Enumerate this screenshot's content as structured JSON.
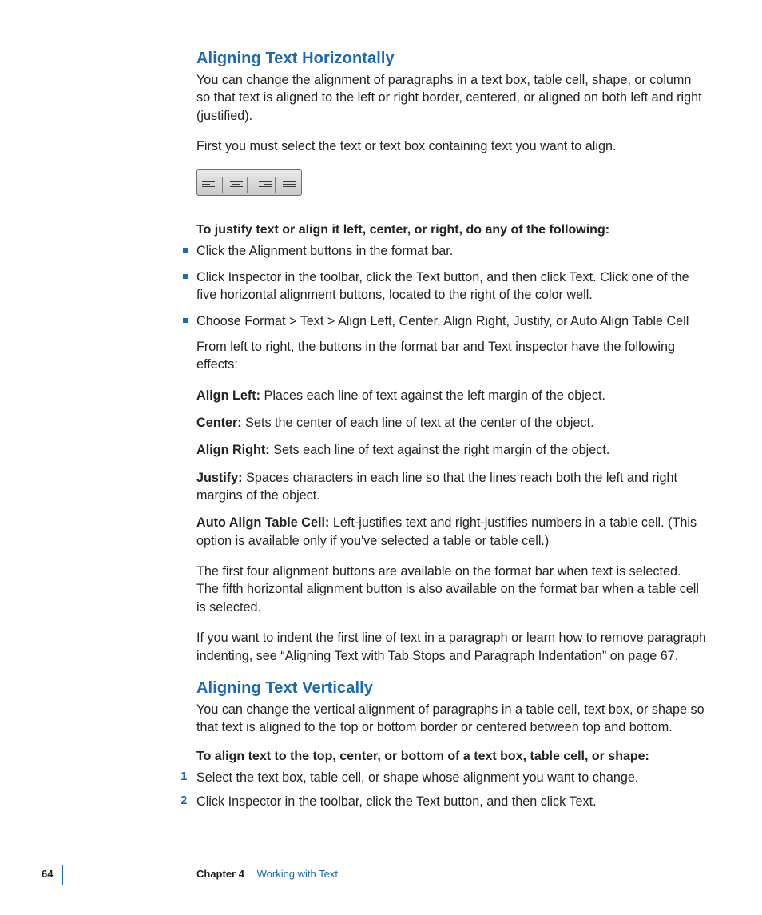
{
  "section1": {
    "heading": "Aligning Text Horizontally",
    "intro": "You can change the alignment of paragraphs in a text box, table cell, shape, or column so that text is aligned to the left or right border, centered, or aligned on both left and right (justified).",
    "selectNote": "First you must select the text or text box containing text you want to align.",
    "lead": "To justify text or align it left, center, or right, do any of the following:",
    "bullets": [
      "Click the Alignment buttons in the format bar.",
      "Click Inspector in the toolbar, click the Text button, and then click Text. Click one of the five horizontal alignment buttons, located to the right of the color well.",
      "Choose Format > Text > Align Left, Center, Align Right, Justify, or Auto Align Table Cell"
    ],
    "afterBullets": "From left to right, the buttons in the format bar and Text inspector have the following effects:",
    "defs": [
      {
        "term": "Align Left:",
        "body": "  Places each line of text against the left margin of the object."
      },
      {
        "term": "Center:",
        "body": "  Sets the center of each line of text at the center of the object."
      },
      {
        "term": "Align Right:",
        "body": "  Sets each line of text against the right margin of the object."
      },
      {
        "term": "Justify:",
        "body": "  Spaces characters in each line so that the lines reach both the left and right margins of the object."
      },
      {
        "term": "Auto Align Table Cell:",
        "body": "  Left-justifies text and right-justifies numbers in a table cell. (This option is available only if you've selected a table or table cell.)"
      }
    ],
    "note1": "The first four alignment buttons are available on the format bar when text is selected. The fifth horizontal alignment button is also available on the format bar when a table cell is selected.",
    "note2": "If you want to indent the first line of text in a paragraph or learn how to remove paragraph indenting, see “Aligning Text with Tab Stops and Paragraph Indentation” on page 67."
  },
  "section2": {
    "heading": "Aligning Text Vertically",
    "intro": "You can change the vertical alignment of paragraphs in a table cell, text box, or shape so that text is aligned to the top or bottom border or centered between top and bottom.",
    "lead": "To align text to the top, center, or bottom of a text box, table cell, or shape:",
    "steps": [
      "Select the text box, table cell, or shape whose alignment you want to change.",
      "Click Inspector in the toolbar, click the Text button, and then click Text."
    ]
  },
  "footer": {
    "page": "64",
    "chapter": "Chapter 4",
    "title": "Working with Text"
  },
  "toolbarIcons": [
    "align-left-icon",
    "align-center-icon",
    "align-right-icon",
    "align-justify-icon"
  ]
}
